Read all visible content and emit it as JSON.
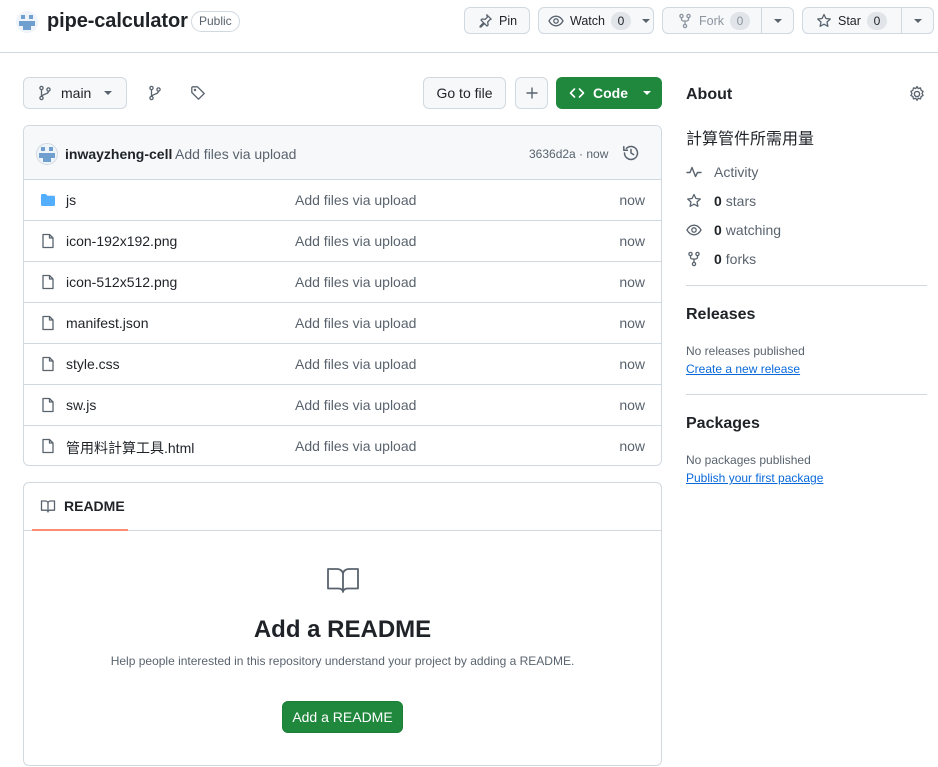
{
  "header": {
    "repo_name": "pipe-calculator",
    "visibility": "Public",
    "pin_label": "Pin",
    "watch_label": "Watch",
    "watch_count": "0",
    "fork_label": "Fork",
    "fork_count": "0",
    "star_label": "Star",
    "star_count": "0"
  },
  "toolbar": {
    "branch": "main",
    "go_to_file": "Go to file",
    "add_icon": "+",
    "code_label": "Code"
  },
  "commit": {
    "author": "inwayzheng-cell",
    "message": "Add files via upload",
    "meta": "3636d2a · now"
  },
  "files": [
    {
      "name": "js",
      "type": "dir",
      "message": "Add files via upload",
      "time": "now"
    },
    {
      "name": "icon-192x192.png",
      "type": "file",
      "message": "Add files via upload",
      "time": "now"
    },
    {
      "name": "icon-512x512.png",
      "type": "file",
      "message": "Add files via upload",
      "time": "now"
    },
    {
      "name": "manifest.json",
      "type": "file",
      "message": "Add files via upload",
      "time": "now"
    },
    {
      "name": "style.css",
      "type": "file",
      "message": "Add files via upload",
      "time": "now"
    },
    {
      "name": "sw.js",
      "type": "file",
      "message": "Add files via upload",
      "time": "now"
    },
    {
      "name": "管用料計算工具.html",
      "type": "file",
      "message": "Add files via upload",
      "time": "now"
    }
  ],
  "readme": {
    "tab_label": "README",
    "title": "Add a README",
    "help": "Help people interested in this repository understand your project by adding a README.",
    "button": "Add a README"
  },
  "about": {
    "title": "About",
    "description": "計算管件所需用量",
    "activity": "Activity",
    "stars_count": "0",
    "stars_label": "stars",
    "watching_count": "0",
    "watching_label": "watching",
    "forks_count": "0",
    "forks_label": "forks"
  },
  "releases": {
    "title": "Releases",
    "note": "No releases published",
    "link": "Create a new release"
  },
  "packages": {
    "title": "Packages",
    "note": "No packages published",
    "link": "Publish your first package"
  },
  "colors": {
    "accent_green": "#1f883d",
    "link_blue": "#0969da",
    "tab_underline": "#fd8c73",
    "folder_blue": "#54aeff"
  }
}
